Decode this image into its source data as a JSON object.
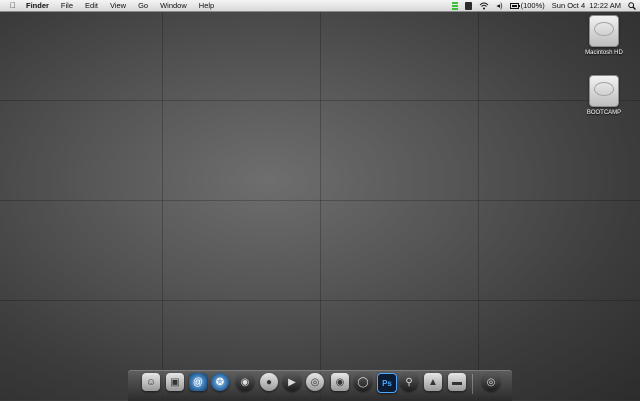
{
  "menubar": {
    "apple_icon": "apple-icon",
    "app_name": "Finder",
    "menus": [
      "File",
      "Edit",
      "View",
      "Go",
      "Window",
      "Help"
    ],
    "battery": "(100%)",
    "clock": "Sun Oct 4  12:22 AM",
    "status_icons": [
      "green-bars-icon",
      "dark-status-icon",
      "wifi-icon",
      "volume-icon",
      "battery-icon",
      "search-icon"
    ]
  },
  "desktop": {
    "drives": [
      {
        "label": "Macintosh HD",
        "icon": "hard-drive-icon"
      },
      {
        "label": "BOOTCAMP",
        "icon": "hard-drive-icon"
      }
    ]
  },
  "dock": {
    "items": [
      {
        "name": "finder",
        "icon": "finder-icon"
      },
      {
        "name": "preview",
        "icon": "preview-icon"
      },
      {
        "name": "mail",
        "icon": "mail-icon"
      },
      {
        "name": "safari",
        "icon": "compass-icon"
      },
      {
        "name": "network",
        "icon": "globe-icon"
      },
      {
        "name": "stormtrooper",
        "icon": "helmet-icon"
      },
      {
        "name": "ichat",
        "icon": "video-chat-icon"
      },
      {
        "name": "mediaplayer",
        "icon": "eye-icon"
      },
      {
        "name": "ipod",
        "icon": "ipod-icon"
      },
      {
        "name": "quicktime",
        "icon": "circle-icon"
      },
      {
        "name": "photoshop",
        "label": "Ps",
        "icon": "photoshop-icon"
      },
      {
        "name": "spotlight",
        "icon": "magnifier-icon"
      },
      {
        "name": "battery-app",
        "icon": "shield-icon"
      },
      {
        "name": "terminal",
        "icon": "terminal-icon"
      },
      {
        "name": "trash",
        "icon": "trash-icon"
      }
    ]
  }
}
